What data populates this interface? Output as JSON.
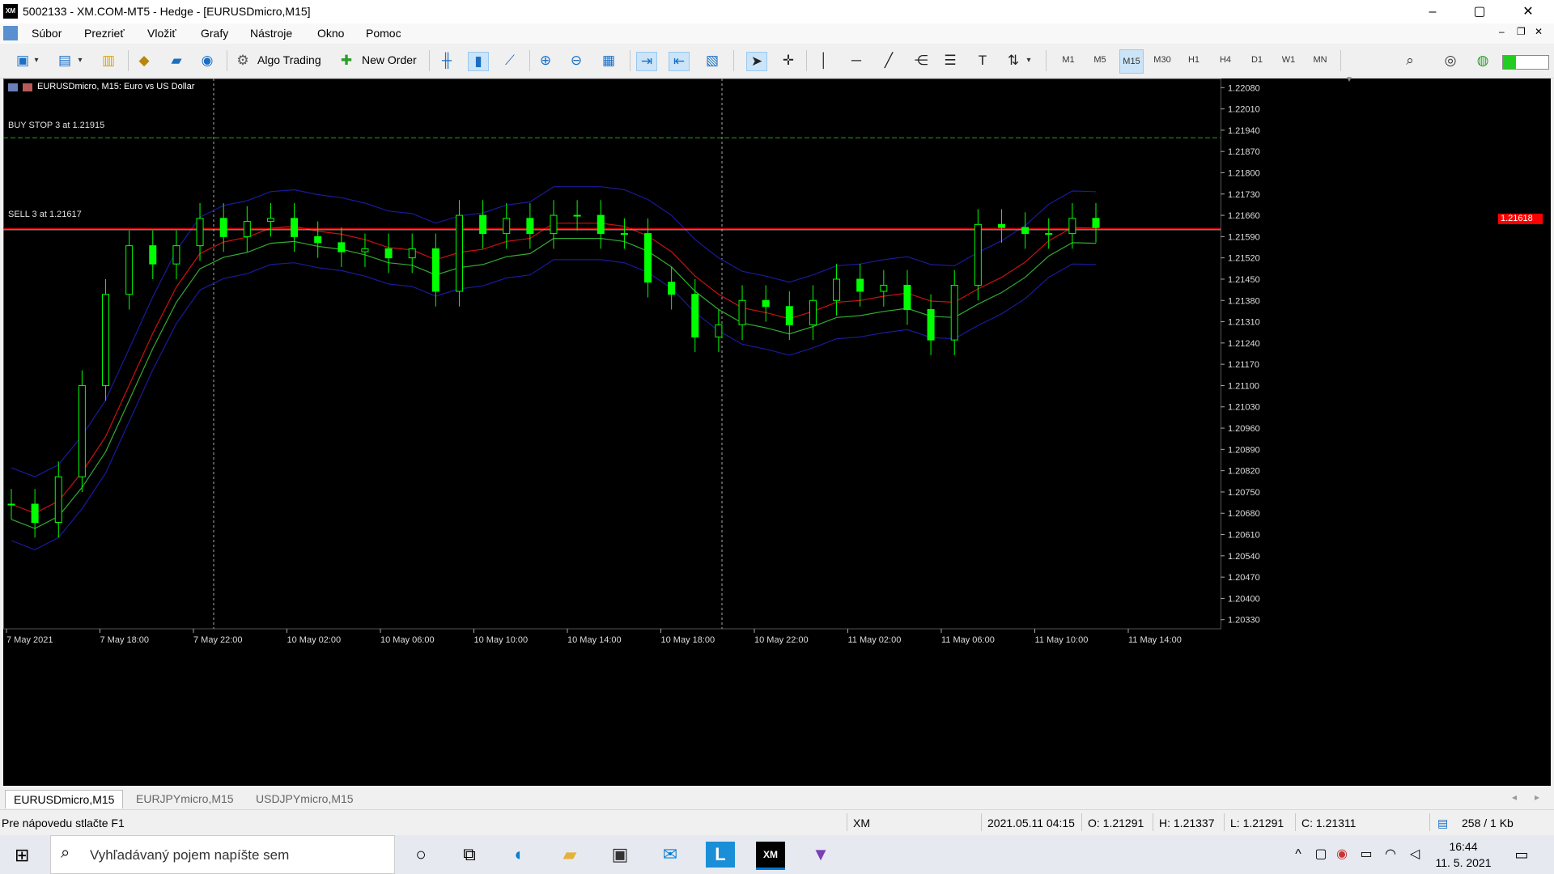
{
  "window": {
    "title": "5002133 - XM.COM-MT5 - Hedge - [EURUSDmicro,M15]",
    "app_icon_text": "XM",
    "controls": [
      "–",
      "▢",
      "✕"
    ]
  },
  "menu": {
    "items": [
      "Súbor",
      "Prezrieť",
      "Vložiť",
      "Grafy",
      "Nástroje",
      "Okno",
      "Pomoc"
    ]
  },
  "toolbar": {
    "algo_trading": "Algo Trading",
    "new_order": "New Order",
    "timeframes": [
      "M1",
      "M5",
      "M15",
      "M30",
      "H1",
      "H4",
      "D1",
      "W1",
      "MN"
    ],
    "active_timeframe": "M15"
  },
  "chart": {
    "symbol_title": "EURUSDmicro, M15:  Euro vs US Dollar",
    "buy_stop_label": "BUY STOP 3 at 1.21915",
    "sell_label": "SELL 3 at 1.21617",
    "current_price": "1.21618",
    "colors": {
      "background": "#000000",
      "candle": "#00ff00",
      "bb_outer": "#cc1111",
      "envelope": "#1a1a9c",
      "ma": "#33aa33",
      "price_line": "#ff0000",
      "buy_stop_line": "#26a026"
    }
  },
  "chart_data": {
    "type": "candlestick",
    "symbol": "EURUSDmicro",
    "timeframe": "M15",
    "y_range": [
      1.203,
      1.2211
    ],
    "price_ticks": [
      "1.22080",
      "1.22010",
      "1.21940",
      "1.21870",
      "1.21800",
      "1.21730",
      "1.21660",
      "1.21590",
      "1.21520",
      "1.21450",
      "1.21380",
      "1.21310",
      "1.21240",
      "1.21170",
      "1.21100",
      "1.21030",
      "1.20960",
      "1.20890",
      "1.20820",
      "1.20750",
      "1.20680",
      "1.20610",
      "1.20540",
      "1.20470",
      "1.20400",
      "1.20330"
    ],
    "time_labels": [
      "7 May 2021",
      "7 May 18:00",
      "7 May 22:00",
      "10 May 02:00",
      "10 May 06:00",
      "10 May 10:00",
      "10 May 14:00",
      "10 May 18:00",
      "10 May 22:00",
      "11 May 02:00",
      "11 May 06:00",
      "11 May 10:00",
      "11 May 14:00"
    ],
    "levels": {
      "buy_stop": 1.21915,
      "sell": 1.21617,
      "current": 1.21618
    },
    "closes_sample": [
      1.2071,
      1.2065,
      1.208,
      1.211,
      1.214,
      1.2156,
      1.215,
      1.2156,
      1.2165,
      1.2159,
      1.2164,
      1.2165,
      1.2159,
      1.2157,
      1.2154,
      1.2155,
      1.2152,
      1.2155,
      1.2141,
      1.2166,
      1.216,
      1.2165,
      1.216,
      1.2166,
      1.2166,
      1.216,
      1.216,
      1.2144,
      1.214,
      1.2126,
      1.213,
      1.2138,
      1.2136,
      1.213,
      1.2138,
      1.2145,
      1.2141,
      1.2143,
      1.2135,
      1.2125,
      1.2143,
      1.2163,
      1.2162,
      1.216,
      1.216,
      1.2165,
      1.2162
    ],
    "ohlc_last": {
      "date": "2021.05.11 04:15",
      "open": "O: 1.21291",
      "high": "H: 1.21337",
      "low": "L: 1.21291",
      "close": "C: 1.21311"
    }
  },
  "tabs": [
    "EURUSDmicro,M15",
    "EURJPYmicro,M15",
    "USDJPYmicro,M15"
  ],
  "status": {
    "help": "Pre nápovedu stlačte F1",
    "profile": "XM",
    "datetime": "2021.05.11 04:15",
    "open": "O: 1.21291",
    "high": "H: 1.21337",
    "low": "L: 1.21291",
    "close": "C: 1.21311",
    "traffic": "258 / 1 Kb"
  },
  "taskbar": {
    "search_placeholder": "Vyhľadávaný pojem napíšte sem",
    "time": "16:44",
    "date": "11. 5. 2021"
  }
}
